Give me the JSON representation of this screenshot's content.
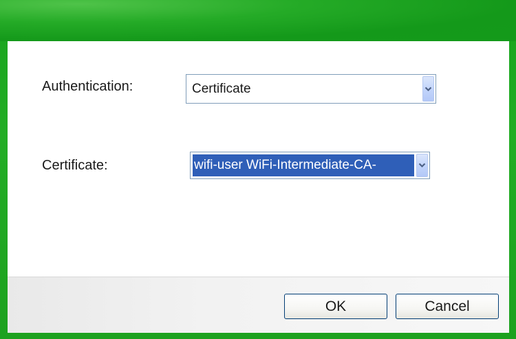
{
  "form": {
    "authentication_label": "Authentication:",
    "authentication_value": "Certificate",
    "certificate_label": "Certificate:",
    "certificate_value": "wifi-user WiFi-Intermediate-CA-"
  },
  "buttons": {
    "ok_label": "OK",
    "cancel_label": "Cancel"
  },
  "colors": {
    "frame": "#1aa51f",
    "selection": "#2f5fb8",
    "combo_border": "#7f9db9"
  },
  "icons": {
    "dropdown": "chevron-down-icon"
  }
}
